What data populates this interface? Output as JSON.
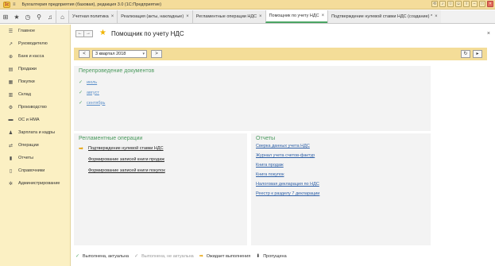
{
  "window": {
    "title": "Бухгалтерия предприятия (базовая), редакция 3.0 (1С:Предприятие)",
    "colors": {
      "titlebar": "#f4dc9a",
      "sidebar": "#fbf0c3",
      "accent_green": "#4aa563"
    }
  },
  "tabs": [
    {
      "label": "Учетная политика",
      "close": "×"
    },
    {
      "label": "Реализация (акты, накладные)",
      "close": "×"
    },
    {
      "label": "Регламентные операции НДС",
      "close": "×"
    },
    {
      "label": "Помощник по учету НДС",
      "close": "×",
      "active": true
    },
    {
      "label": "Подтверждение нулевой ставки НДС (создание) *",
      "close": "×"
    }
  ],
  "sidebar": {
    "items": [
      {
        "label": "Главное",
        "icon": "menu-icon"
      },
      {
        "label": "Руководителю",
        "icon": "chart-line-icon"
      },
      {
        "label": "Банк и касса",
        "icon": "bank-icon"
      },
      {
        "label": "Продажи",
        "icon": "cart-out-icon"
      },
      {
        "label": "Покупки",
        "icon": "cart-in-icon"
      },
      {
        "label": "Склад",
        "icon": "warehouse-icon"
      },
      {
        "label": "Производство",
        "icon": "factory-icon"
      },
      {
        "label": "ОС и НМА",
        "icon": "truck-icon"
      },
      {
        "label": "Зарплата и кадры",
        "icon": "person-icon"
      },
      {
        "label": "Операции",
        "icon": "operations-icon"
      },
      {
        "label": "Отчеты",
        "icon": "bar-chart-icon"
      },
      {
        "label": "Справочники",
        "icon": "book-icon"
      },
      {
        "label": "Администрирование",
        "icon": "gear-icon"
      }
    ]
  },
  "page": {
    "title": "Помощник по учету НДС",
    "period": "3 квартал 2018",
    "period_prev": "<",
    "period_next": ">"
  },
  "reposting": {
    "title": "Перепроведение документов",
    "items": [
      "июль",
      "август",
      "сентябрь"
    ]
  },
  "operations": {
    "title": "Регламентные операции",
    "items": [
      {
        "label": "Подтверждение нулевой ставки НДС",
        "status": "waiting"
      },
      {
        "label": "Формирование записей книги продаж",
        "status": "none"
      },
      {
        "label": "Формирование записей книги покупок",
        "status": "none"
      }
    ]
  },
  "reports": {
    "title": "Отчеты",
    "items": [
      "Сверка данных учета НДС",
      "Журнал учета счетов-фактур",
      "Книга продаж",
      "Книга покупок",
      "Налоговая декларация по НДС",
      "Реестр к разделу 7 декларации"
    ]
  },
  "legend": {
    "done_actual": "Выполнена, актуальна",
    "done_not_actual": "Выполнена, не актуальна",
    "waiting": "Ожидает выполнения",
    "skipped": "Пропущена"
  }
}
